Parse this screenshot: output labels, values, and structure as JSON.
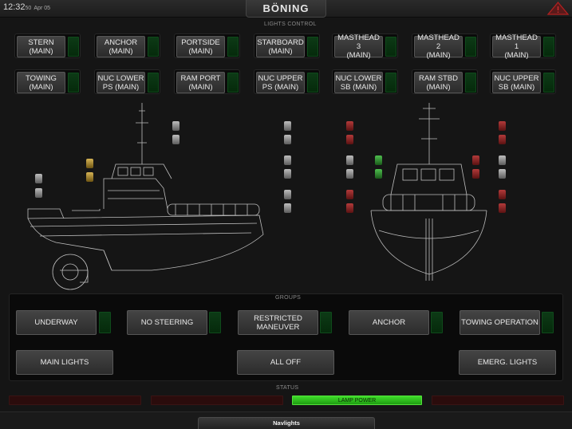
{
  "header": {
    "time": "12:32",
    "seconds": "50",
    "date": "Apr 05",
    "brand": "BÖNING"
  },
  "lights_control": {
    "label": "LIGHTS CONTROL",
    "row1": [
      {
        "label": "STERN\n(MAIN)"
      },
      {
        "label": "ANCHOR\n(MAIN)"
      },
      {
        "label": "PORTSIDE\n(MAIN)"
      },
      {
        "label": "STARBOARD\n(MAIN)"
      },
      {
        "label": "MASTHEAD 3\n(MAIN)"
      },
      {
        "label": "MASTHEAD 2\n(MAIN)"
      },
      {
        "label": "MASTHEAD 1\n(MAIN)"
      }
    ],
    "row2": [
      {
        "label": "TOWING\n(MAIN)"
      },
      {
        "label": "NUC LOWER\nPS (MAIN)"
      },
      {
        "label": "RAM PORT\n(MAIN)"
      },
      {
        "label": "NUC UPPER\nPS (MAIN)"
      },
      {
        "label": "NUC LOWER\nSB (MAIN)"
      },
      {
        "label": "RAM STBD\n(MAIN)"
      },
      {
        "label": "NUC UPPER\nSB (MAIN)"
      }
    ]
  },
  "groups": {
    "label": "GROUPS",
    "underway": "UNDERWAY",
    "no_steering": "NO STEERING",
    "restricted": "RESTRICTED\nMANEUVER",
    "anchor": "ANCHOR",
    "towing": "TOWING OPERATION",
    "main_lights": "MAIN LIGHTS",
    "all_off": "ALL OFF",
    "emerg": "EMERG. LIGHTS"
  },
  "status": {
    "label": "STATUS",
    "bars": [
      "",
      "",
      "LAMP POWER",
      ""
    ]
  },
  "footer": {
    "tab": "Navlights"
  },
  "colors": {
    "indicator_off_green": "#0d3a16",
    "status_on": "#3fdc2a",
    "status_off": "#2b0c0c"
  }
}
